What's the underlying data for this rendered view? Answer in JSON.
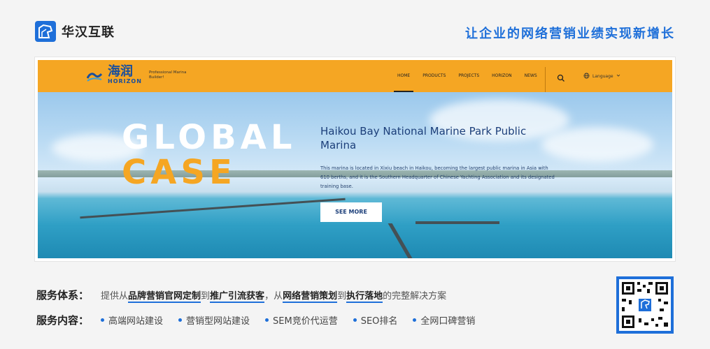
{
  "brand": {
    "name": "华汉互联",
    "slogan": "让企业的网络营销业绩实现新增长"
  },
  "site": {
    "logo": {
      "cn": "海润",
      "en": "HORIZON",
      "sub": "Professional Marina Builder!"
    },
    "nav": [
      "HOME",
      "PRODUCTS",
      "PROJECTS",
      "HORIZON",
      "NEWS"
    ],
    "active_nav": "HOME",
    "language_label": "Language",
    "hero": {
      "word1": "GLOBAL",
      "word2": "CASE",
      "title": "Haikou Bay National Marine Park Public Marina",
      "description": "This marina is located in Xixiu beach in Haikou, becoming the largest public marina in Asia with 610 berths, and it is the Southern Headquarter of Chinese Yachting Association and its designated training base.",
      "button": "SEE MORE"
    }
  },
  "services": {
    "system_label": "服务体系：",
    "system_parts": [
      "提供从",
      "品牌营销官网定制",
      "到",
      "推广引流获客",
      "，从",
      "网络营销策划",
      "到",
      "执行落地",
      "的完整解决方案"
    ],
    "content_label": "服务内容：",
    "content_items": [
      "高端网站建设",
      "营销型网站建设",
      "SEM竞价代运营",
      "SEO排名",
      "全网口碑营销"
    ]
  },
  "colors": {
    "accent": "#1e6fd9",
    "nav_orange": "#f5a623"
  }
}
